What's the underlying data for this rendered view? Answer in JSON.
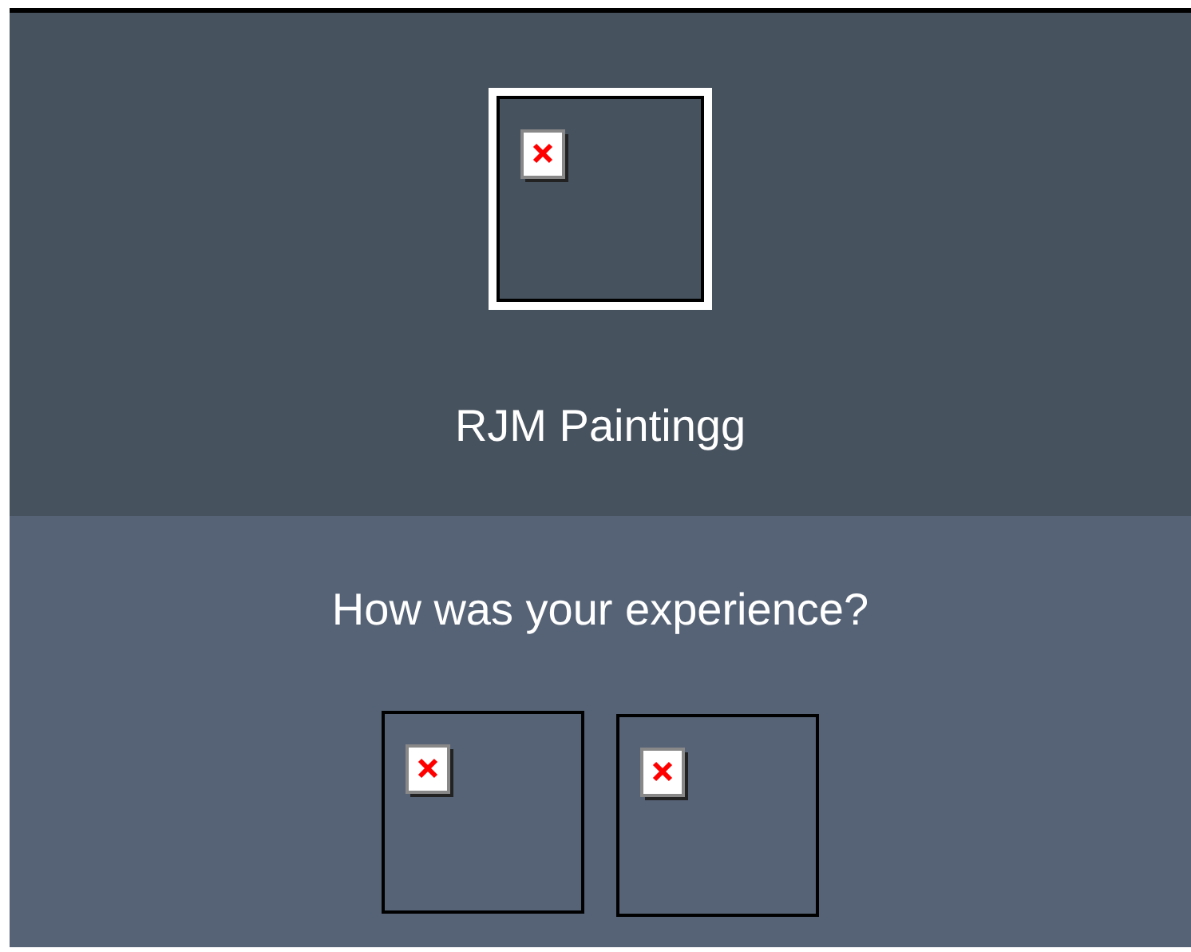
{
  "header": {
    "logo": {
      "kind": "broken-image"
    },
    "title": "RJM Paintingg"
  },
  "feedback": {
    "question": "How was your experience?",
    "options": [
      {
        "kind": "broken-image"
      },
      {
        "kind": "broken-image"
      }
    ]
  }
}
